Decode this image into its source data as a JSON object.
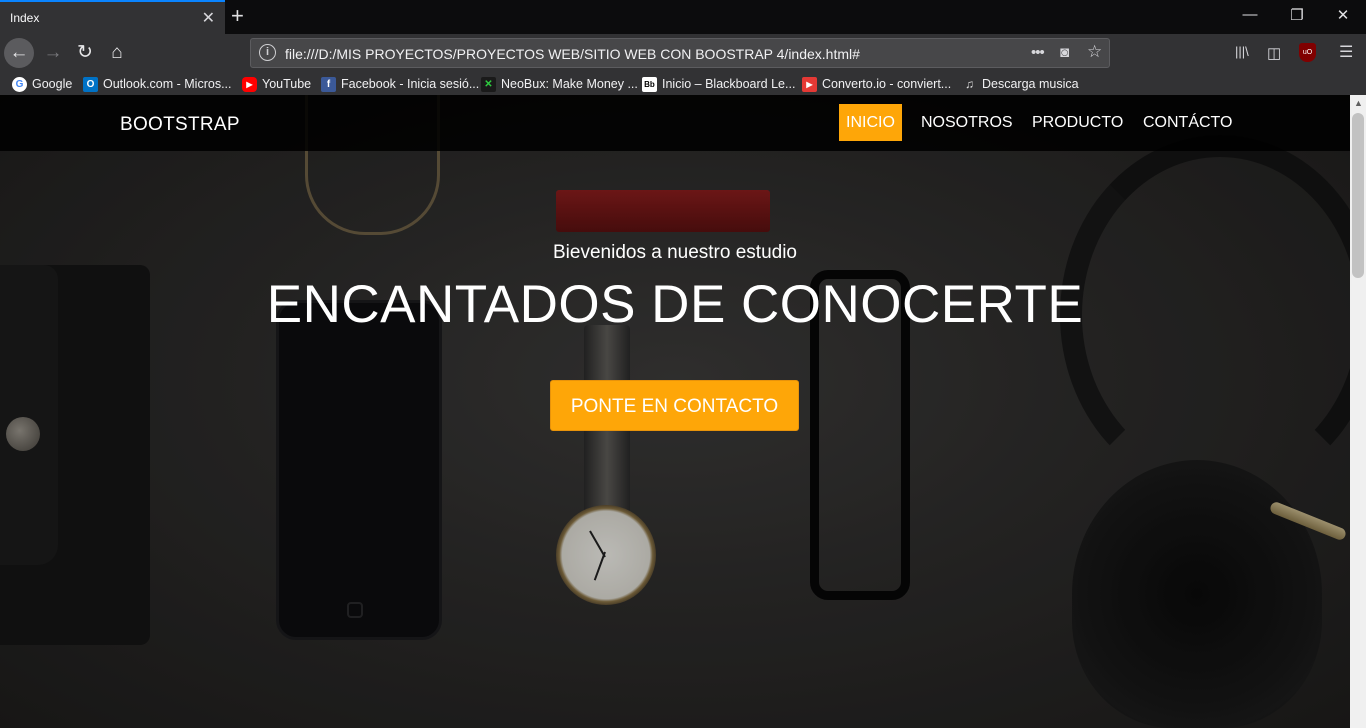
{
  "browser": {
    "tab_title": "Index",
    "tab_close_icon": "✕",
    "new_tab_icon": "+",
    "window_controls": {
      "minimize": "—",
      "restore": "❐",
      "close": "✕"
    },
    "nav": {
      "back": "←",
      "forward": "→",
      "reload": "↻",
      "home": "⌂"
    },
    "url": "file:///D:/MIS PROYECTOS/PROYECTOS WEB/SITIO WEB CON BOOSTRAP 4/index.html#",
    "url_actions": {
      "more": "•••",
      "pocket": "◙",
      "bookmark": "☆"
    },
    "toolbar_right": {
      "library": "|||\\",
      "sidebar": "◫",
      "ublock": "uO",
      "menu": "☰"
    },
    "bookmarks": [
      {
        "label": "Google",
        "icon": "G",
        "color": "#4285f4"
      },
      {
        "label": "Outlook.com - Micros...",
        "icon": "O",
        "color": "#0072c6"
      },
      {
        "label": "YouTube",
        "icon": "▶",
        "color": "#ff0000"
      },
      {
        "label": "Facebook - Inicia sesió...",
        "icon": "f",
        "color": "#3b5998"
      },
      {
        "label": "NeoBux: Make Money ...",
        "icon": "✕",
        "color": "#2e9b3e"
      },
      {
        "label": "Inicio – Blackboard Le...",
        "icon": "Bb",
        "color": "#222222"
      },
      {
        "label": "Converto.io - conviert...",
        "icon": "▶",
        "color": "#e53935"
      },
      {
        "label": "Descarga musica",
        "icon": "♫",
        "color": "#555555"
      }
    ]
  },
  "site": {
    "brand": "BOOTSTRAP",
    "menu": [
      "INICIO",
      "NOSOTROS",
      "PRODUCTO",
      "CONTÁCTO"
    ],
    "active_menu_index": 0,
    "accent_color": "#fea608",
    "hero": {
      "subtitle": "Bievenidos a nuestro estudio",
      "title": "ENCANTADOS DE CONOCERTE",
      "cta": "PONTE EN CONTACTO"
    }
  },
  "scrollbar": {
    "up_icon": "▲"
  }
}
